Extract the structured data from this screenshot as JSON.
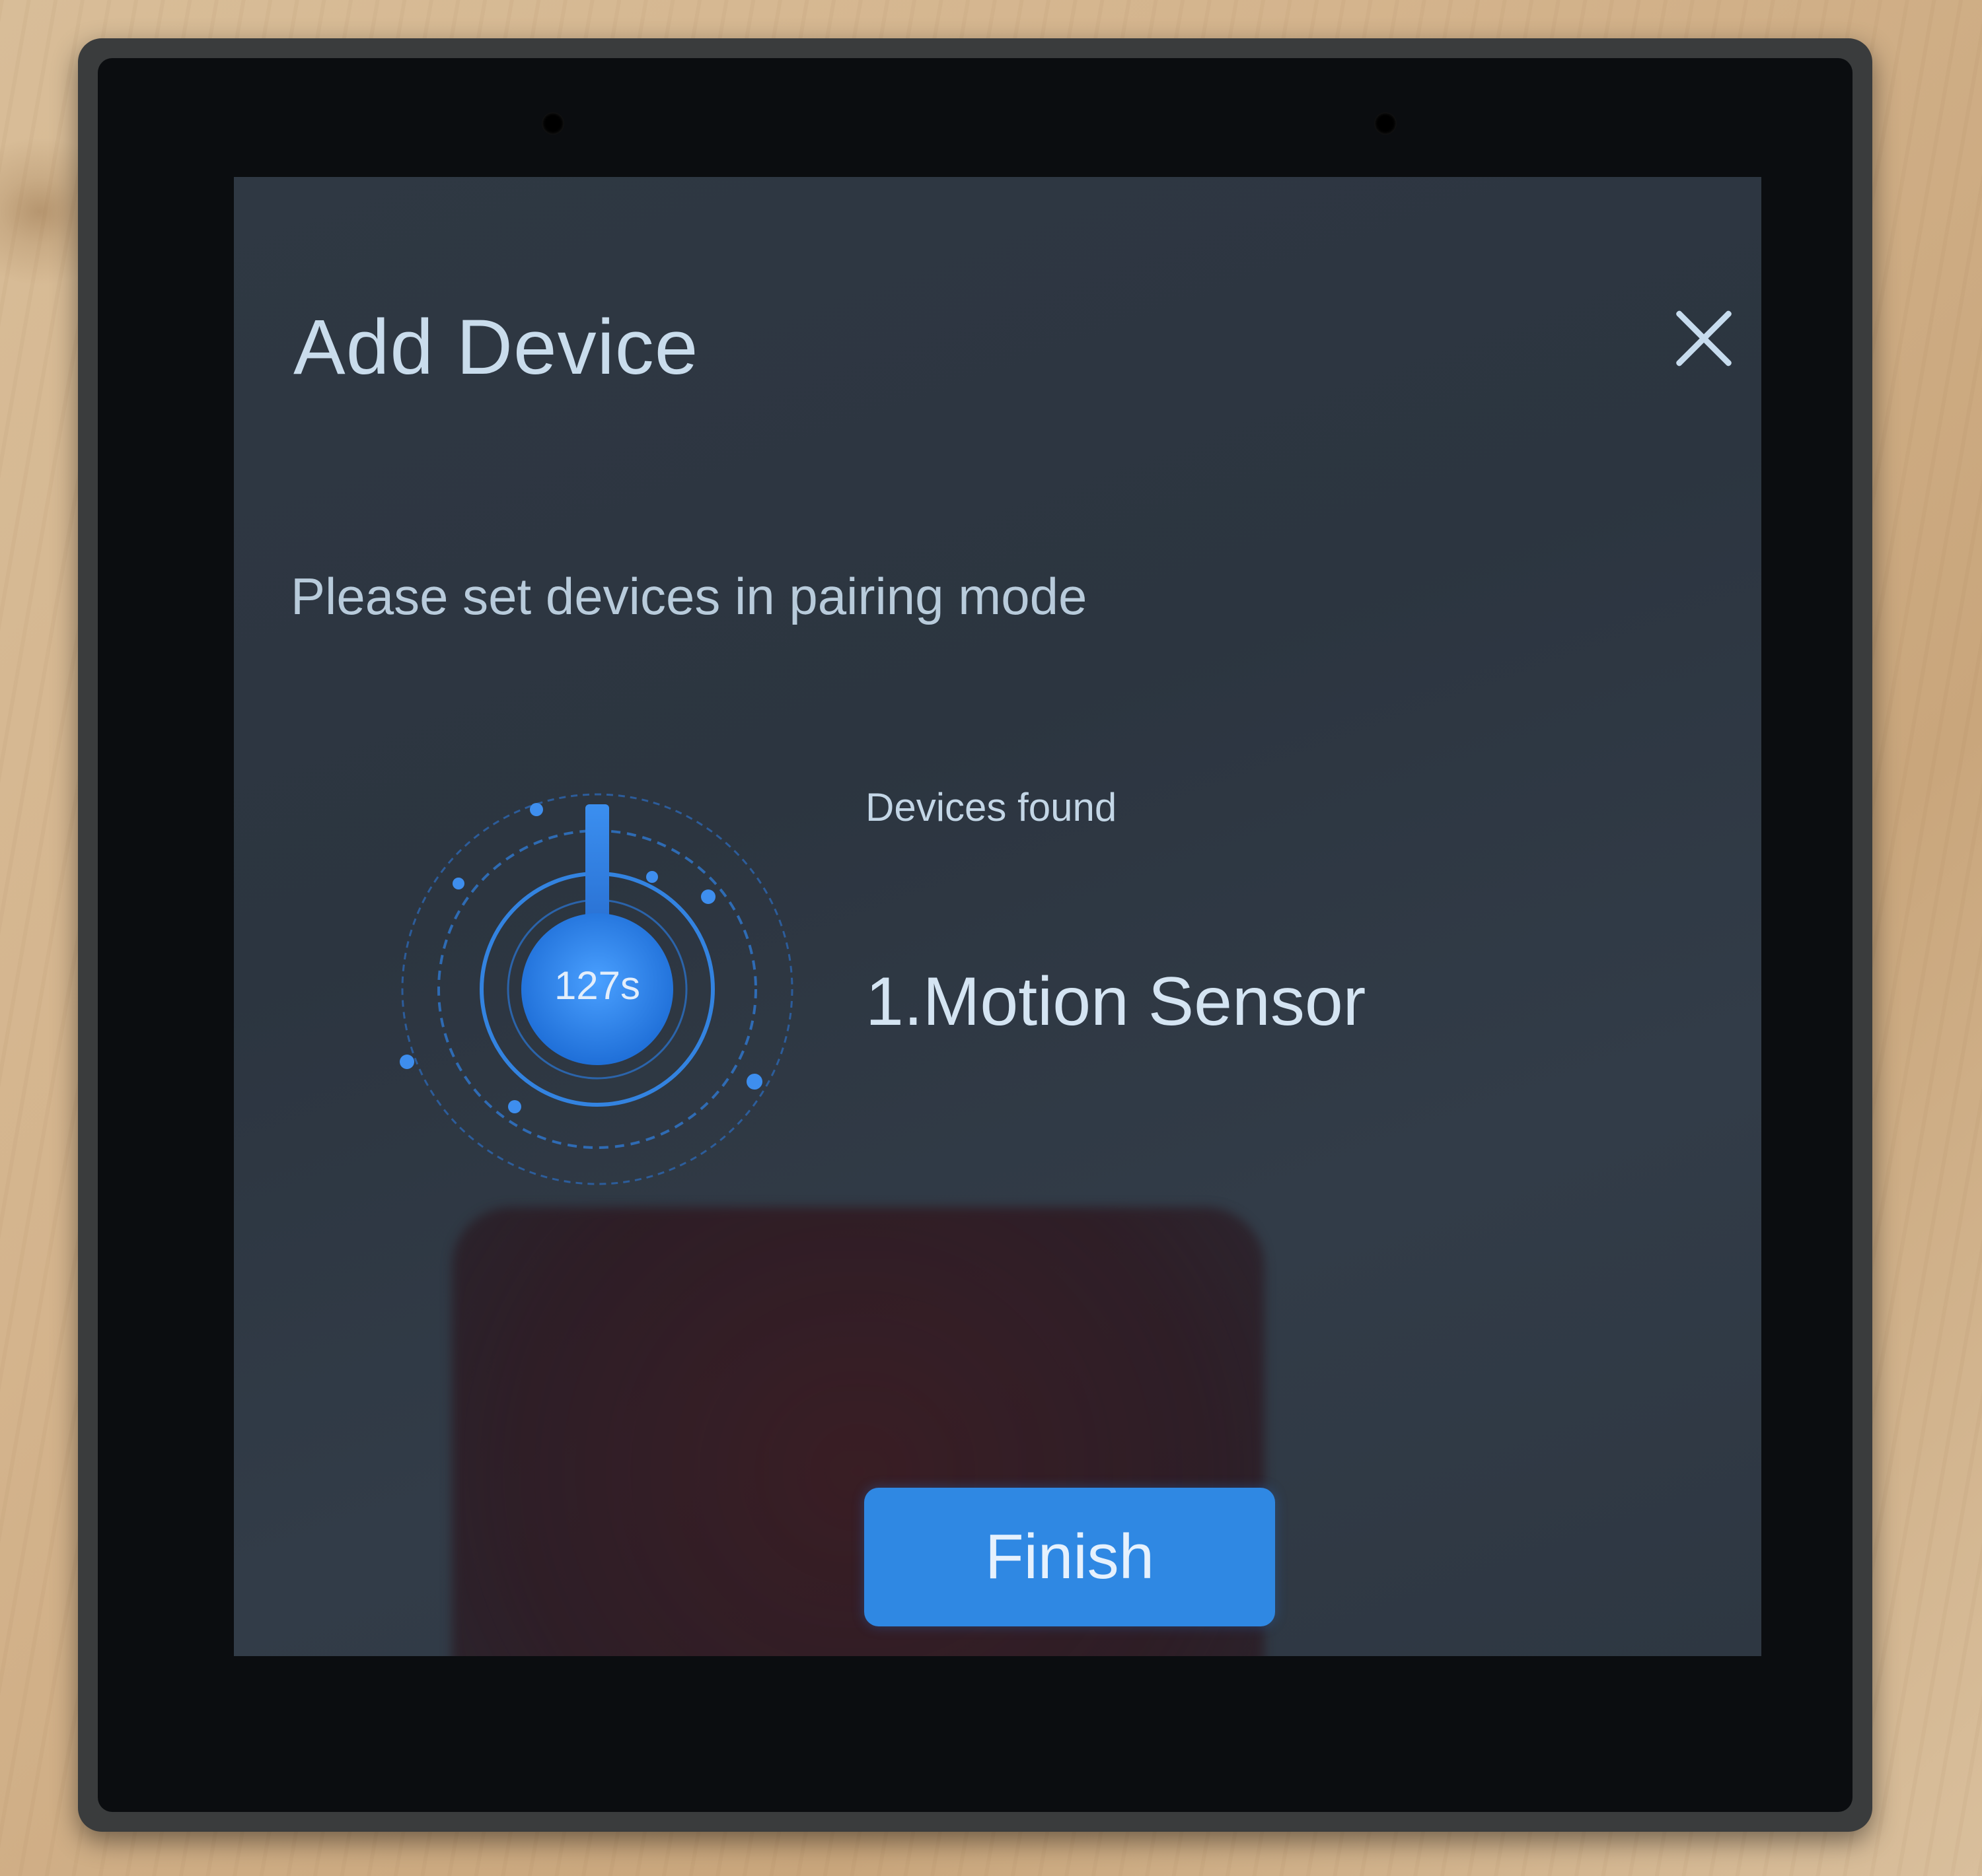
{
  "dialog": {
    "title": "Add Device",
    "close_icon": "close-icon",
    "instruction": "Please set devices in pairing mode"
  },
  "scan": {
    "countdown": "127s",
    "found_label": "Devices found",
    "devices": [
      "1.Motion Sensor"
    ],
    "accent_color": "#2f88e3"
  },
  "actions": {
    "finish_label": "Finish"
  }
}
